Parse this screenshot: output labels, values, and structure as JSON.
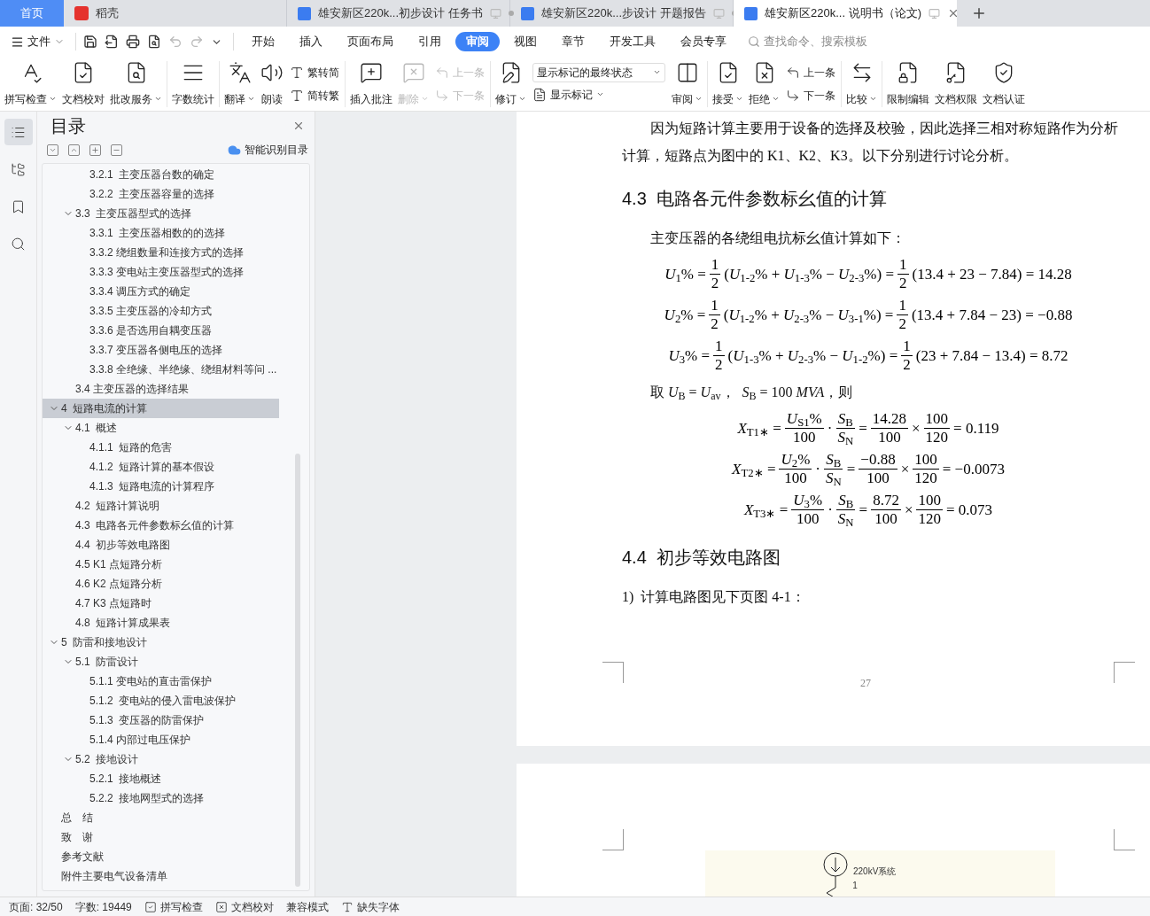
{
  "tabs": [
    {
      "label": "首页",
      "kind": "home",
      "selected": false
    },
    {
      "label": "稻壳",
      "kind": "app",
      "selected": false
    },
    {
      "label": "雄安新区220k...初步设计 任务书",
      "kind": "doc",
      "selected": false
    },
    {
      "label": "雄安新区220k...步设计 开题报告",
      "kind": "doc",
      "selected": false
    },
    {
      "label": "雄安新区220k... 说明书（论文)",
      "kind": "doc",
      "selected": true
    }
  ],
  "menu": {
    "file": "文件",
    "quick_access": [
      {
        "disabled": false
      },
      {
        "disabled": false
      },
      {
        "disabled": false
      },
      {
        "disabled": false
      },
      {
        "disabled": true
      },
      {
        "disabled": true
      }
    ],
    "tabs": [
      {
        "label": "开始",
        "selected": false
      },
      {
        "label": "插入",
        "selected": false
      },
      {
        "label": "页面布局",
        "selected": false
      },
      {
        "label": "引用",
        "selected": false
      },
      {
        "label": "审阅",
        "selected": true
      },
      {
        "label": "视图",
        "selected": false
      },
      {
        "label": "章节",
        "selected": false
      },
      {
        "label": "开发工具",
        "selected": false
      },
      {
        "label": "会员专享",
        "selected": false
      }
    ],
    "search": {
      "placeholder": "查找命令、搜索模板"
    }
  },
  "ribbon": {
    "groups": [
      {
        "items": [
          {
            "kind": "large",
            "label": "拼写检查",
            "dropdown": true,
            "disabled": false
          },
          {
            "kind": "large",
            "label": "文档校对",
            "dropdown": false,
            "disabled": false
          },
          {
            "kind": "large",
            "label": "批改服务",
            "dropdown": true,
            "disabled": false
          }
        ]
      },
      {
        "items": [
          {
            "kind": "large",
            "label": "字数统计",
            "dropdown": false,
            "disabled": false
          }
        ]
      },
      {
        "items": [
          {
            "kind": "large",
            "label": "翻译",
            "dropdown": true,
            "disabled": false
          },
          {
            "kind": "large",
            "label": "朗读",
            "dropdown": false,
            "disabled": false
          },
          {
            "kind": "stack",
            "rows": [
              {
                "kind": "button",
                "label": "繁转简",
                "dropdown": false,
                "disabled": false
              },
              {
                "kind": "button",
                "label": "简转繁",
                "dropdown": false,
                "disabled": false
              }
            ]
          }
        ]
      },
      {
        "items": [
          {
            "kind": "large",
            "label": "插入批注",
            "dropdown": false,
            "disabled": false
          },
          {
            "kind": "large",
            "label": "删除",
            "dropdown": true,
            "disabled": true
          },
          {
            "kind": "stack",
            "rows": [
              {
                "kind": "button",
                "label": "上一条",
                "dropdown": false,
                "disabled": true
              },
              {
                "kind": "button",
                "label": "下一条",
                "dropdown": false,
                "disabled": true
              }
            ]
          }
        ]
      },
      {
        "items": [
          {
            "kind": "large",
            "label": "修订",
            "dropdown": true,
            "disabled": false
          },
          {
            "kind": "stack",
            "rows": [
              {
                "kind": "select",
                "value": "显示标记的最终状态"
              },
              {
                "kind": "button",
                "label": "显示标记",
                "dropdown": true,
                "disabled": false
              }
            ]
          },
          {
            "kind": "large",
            "label": "审阅",
            "dropdown": true,
            "disabled": false
          }
        ]
      },
      {
        "items": [
          {
            "kind": "large",
            "label": "接受",
            "dropdown": true,
            "disabled": false
          },
          {
            "kind": "large",
            "label": "拒绝",
            "dropdown": true,
            "disabled": false
          },
          {
            "kind": "stack",
            "rows": [
              {
                "kind": "button",
                "label": "上一条",
                "dropdown": false,
                "disabled": false
              },
              {
                "kind": "button",
                "label": "下一条",
                "dropdown": false,
                "disabled": false
              }
            ]
          }
        ]
      },
      {
        "items": [
          {
            "kind": "large",
            "label": "比较",
            "dropdown": true,
            "disabled": false
          }
        ]
      },
      {
        "items": [
          {
            "kind": "large",
            "label": "限制编辑",
            "dropdown": false,
            "disabled": false
          },
          {
            "kind": "large",
            "label": "文档权限",
            "dropdown": false,
            "disabled": false
          },
          {
            "kind": "large",
            "label": "文档认证",
            "dropdown": false,
            "disabled": false
          }
        ]
      }
    ]
  },
  "nav_icons": [
    {
      "kind": "toc",
      "selected": true
    },
    {
      "kind": "outline",
      "selected": false
    },
    {
      "kind": "bookmark",
      "selected": false
    },
    {
      "kind": "search",
      "selected": false
    }
  ],
  "toc": {
    "title": "目录",
    "smart_button": "智能识别目录",
    "items": [
      {
        "children": [
          {
            "children": [
              {
                "label": "3.2.1  主变压器台数的确定",
                "selected": false
              },
              {
                "label": "3.2.2  主变压器容量的选择",
                "selected": false
              }
            ]
          },
          {
            "label": "3.3  主变压器型式的选择",
            "selected": false,
            "expanded": true,
            "children": [
              {
                "label": "3.3.1  主变压器相数的的选择",
                "selected": false
              },
              {
                "label": "3.3.2 绕组数量和连接方式的选择",
                "selected": false
              },
              {
                "label": "3.3.3 变电站主变压器型式的选择",
                "selected": false
              },
              {
                "label": "3.3.4 调压方式的确定",
                "selected": false
              },
              {
                "label": "3.3.5 主变压器的冷却方式",
                "selected": false
              },
              {
                "label": "3.3.6 是否选用自耦变压器",
                "selected": false
              },
              {
                "label": "3.3.7 变压器各侧电压的选择",
                "selected": false
              },
              {
                "label": "3.3.8 全绝缘、半绝缘、绕组材料等问 ...",
                "selected": false
              }
            ]
          },
          {
            "label": "3.4 主变压器的选择结果",
            "selected": false
          }
        ]
      },
      {
        "label": "4  短路电流的计算",
        "selected": true,
        "expanded": true,
        "children": [
          {
            "label": "4.1  概述",
            "selected": false,
            "expanded": true,
            "children": [
              {
                "label": "4.1.1  短路的危害",
                "selected": false
              },
              {
                "label": "4.1.2  短路计算的基本假设",
                "selected": false
              },
              {
                "label": "4.1.3  短路电流的计算程序",
                "selected": false
              }
            ]
          },
          {
            "label": "4.2  短路计算说明",
            "selected": false
          },
          {
            "label": "4.3  电路各元件参数标幺值的计算",
            "selected": false
          },
          {
            "label": "4.4  初步等效电路图",
            "selected": false
          },
          {
            "label": "4.5 K1 点短路分析",
            "selected": false
          },
          {
            "label": "4.6 K2 点短路分析",
            "selected": false
          },
          {
            "label": "4.7 K3 点短路时",
            "selected": false
          },
          {
            "label": "4.8  短路计算成果表",
            "selected": false
          }
        ]
      },
      {
        "label": "5  防雷和接地设计",
        "selected": false,
        "expanded": true,
        "children": [
          {
            "label": "5.1  防雷设计",
            "selected": false,
            "expanded": true,
            "children": [
              {
                "label": "5.1.1 变电站的直击雷保护",
                "selected": false
              },
              {
                "label": "5.1.2  变电站的侵入雷电波保护",
                "selected": false
              },
              {
                "label": "5.1.3  变压器的防雷保护",
                "selected": false
              },
              {
                "label": "5.1.4 内部过电压保护",
                "selected": false
              }
            ]
          },
          {
            "label": "5.2  接地设计",
            "selected": false,
            "expanded": true,
            "children": [
              {
                "label": "5.2.1  接地概述",
                "selected": false
              },
              {
                "label": "5.2.2  接地网型式的选择",
                "selected": false
              }
            ]
          }
        ]
      },
      {
        "label": "总　结",
        "selected": false
      },
      {
        "label": "致　谢",
        "selected": false
      },
      {
        "label": "参考文献",
        "selected": false
      },
      {
        "label": "附件主要电气设备清单",
        "selected": false
      }
    ]
  },
  "document": {
    "page": [
      {
        "kind": "paragraph",
        "indent": true,
        "lines": [
          "因为短路计算主要用于设备的选择及校验，因此选择三相对称短路作为分析",
          "计算，短路点为图中的 K1、K2、K3。以下分别进行讨论分析。"
        ]
      },
      {
        "kind": "heading",
        "text": "4.3  电路各元件参数标幺值的计算"
      },
      {
        "kind": "paragraph",
        "indent": true,
        "lines": [
          "主变压器的各绕组电抗标幺值计算如下："
        ]
      },
      {
        "kind": "equation",
        "parts": [
          {
            "kind": "text",
            "text": "*U*$_{1}$% ="
          },
          {
            "kind": "frac",
            "num": "1",
            "den": "2"
          },
          {
            "kind": "text",
            "text": "(*U*$_{1-2}$% + *U*$_{1-3}$% − *U*$_{2-3}$%) ="
          },
          {
            "kind": "frac",
            "num": "1",
            "den": "2"
          },
          {
            "kind": "text",
            "text": "(13.4 + 23 − 7.84) = 14.28"
          }
        ]
      },
      {
        "kind": "equation",
        "parts": [
          {
            "kind": "text",
            "text": "*U*$_{2}$% ="
          },
          {
            "kind": "frac",
            "num": "1",
            "den": "2"
          },
          {
            "kind": "text",
            "text": "(*U*$_{1-2}$% + *U*$_{2-3}$% − *U*$_{3-1}$%) ="
          },
          {
            "kind": "frac",
            "num": "1",
            "den": "2"
          },
          {
            "kind": "text",
            "text": "(13.4 + 7.84 − 23) = −0.88"
          }
        ]
      },
      {
        "kind": "equation",
        "parts": [
          {
            "kind": "text",
            "text": "*U*$_{3}$% ="
          },
          {
            "kind": "frac",
            "num": "1",
            "den": "2"
          },
          {
            "kind": "text",
            "text": "(*U*$_{1-3}$% + *U*$_{2-3}$% − *U*$_{1-2}$%) ="
          },
          {
            "kind": "frac",
            "num": "1",
            "den": "2"
          },
          {
            "kind": "text",
            "text": "(23 + 7.84 − 13.4) = 8.72"
          }
        ]
      },
      {
        "kind": "paragraph",
        "indent": true,
        "lines": [
          "取 *U*$_{B}$ = *U*$_{av}$，  *S*$_{B}$ = 100 *MVA*，则"
        ]
      },
      {
        "kind": "equation",
        "parts": [
          {
            "kind": "text",
            "text": "*X*$_{T1∗}$ ="
          },
          {
            "kind": "frac",
            "num": "*U*$_{S1}$%",
            "den": "100"
          },
          {
            "kind": "text",
            "text": "·"
          },
          {
            "kind": "frac",
            "num": "*S*$_{B}$",
            "den": "*S*$_{N}$"
          },
          {
            "kind": "text",
            "text": "="
          },
          {
            "kind": "frac",
            "num": "14.28",
            "den": "100"
          },
          {
            "kind": "text",
            "text": "×"
          },
          {
            "kind": "frac",
            "num": "100",
            "den": "120"
          },
          {
            "kind": "text",
            "text": "= 0.119"
          }
        ]
      },
      {
        "kind": "equation",
        "parts": [
          {
            "kind": "text",
            "text": "*X*$_{T2∗}$ ="
          },
          {
            "kind": "frac",
            "num": "*U*$_{2}$%",
            "den": "100"
          },
          {
            "kind": "text",
            "text": "·"
          },
          {
            "kind": "frac",
            "num": "*S*$_{B}$",
            "den": "*S*$_{N}$"
          },
          {
            "kind": "text",
            "text": "="
          },
          {
            "kind": "frac",
            "num": "−0.88",
            "den": "100"
          },
          {
            "kind": "text",
            "text": "×"
          },
          {
            "kind": "frac",
            "num": "100",
            "den": "120"
          },
          {
            "kind": "text",
            "text": "= −0.0073"
          }
        ]
      },
      {
        "kind": "equation",
        "parts": [
          {
            "kind": "text",
            "text": "*X*$_{T3∗}$ ="
          },
          {
            "kind": "frac",
            "num": "*U*$_{3}$%",
            "den": "100"
          },
          {
            "kind": "text",
            "text": "·"
          },
          {
            "kind": "frac",
            "num": "*S*$_{B}$",
            "den": "*S*$_{N}$"
          },
          {
            "kind": "text",
            "text": "="
          },
          {
            "kind": "frac",
            "num": "8.72",
            "den": "100"
          },
          {
            "kind": "text",
            "text": "×"
          },
          {
            "kind": "frac",
            "num": "100",
            "den": "120"
          },
          {
            "kind": "text",
            "text": "= 0.073"
          }
        ]
      },
      {
        "kind": "heading",
        "text": "4.4  初步等效电路图"
      },
      {
        "kind": "paragraph",
        "indent": false,
        "lines": [
          "1)  计算电路图见下页图 4-1："
        ]
      }
    ],
    "page_number": "27",
    "next_page_figure": {
      "source_label": "220kV系统",
      "node_label": "1"
    }
  },
  "status_bar": [
    {
      "kind": "text",
      "label": "页面: 32/50"
    },
    {
      "kind": "text",
      "label": "字数: 19449"
    },
    {
      "kind": "spell",
      "label": "拼写检查"
    },
    {
      "kind": "proof",
      "label": "文档校对"
    },
    {
      "kind": "text",
      "label": "兼容模式"
    },
    {
      "kind": "font",
      "label": "缺失字体"
    }
  ]
}
